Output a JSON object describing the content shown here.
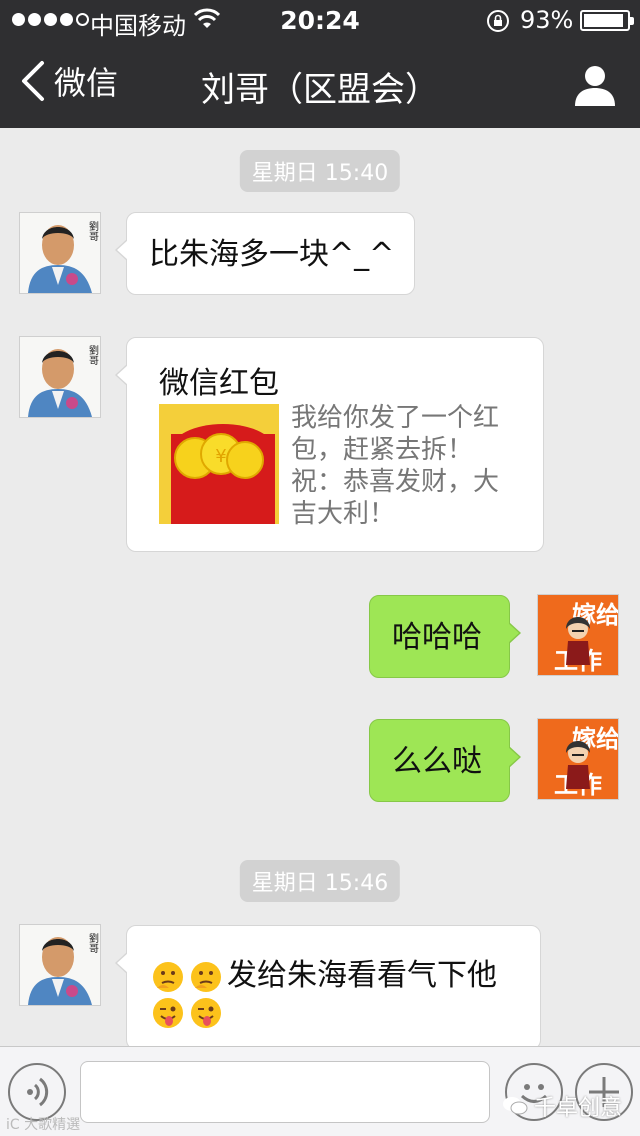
{
  "status_bar": {
    "carrier": "中国移动",
    "time": "20:24",
    "battery_percent_label": "93%",
    "battery_level": 0.93
  },
  "nav": {
    "back_label": "微信",
    "title": "刘哥（区盟会）"
  },
  "messages": {
    "time_1": "星期日 15:40",
    "m1_text": "比朱海多一块^_^",
    "redpacket": {
      "title": "微信红包",
      "description": "我给你发了一个红包，赶紧去拆！祝：恭喜发财，大吉大利！"
    },
    "out_1": "哈哈哈",
    "out_2": "么么哒",
    "time_2": "星期日 15:46",
    "m3_text": "发给朱海看看气下他"
  },
  "avatar_text": {
    "contact": "劉哥",
    "self_top": "嫁给",
    "self_bottom": "工作"
  },
  "watermark": {
    "left": "iC 大歌精選",
    "right": "千卓创意"
  },
  "colors": {
    "topbar": "#2f2f31",
    "chat_bg": "#ebebeb",
    "outgoing_bubble": "#9ee655",
    "incoming_bubble": "#ffffff"
  }
}
